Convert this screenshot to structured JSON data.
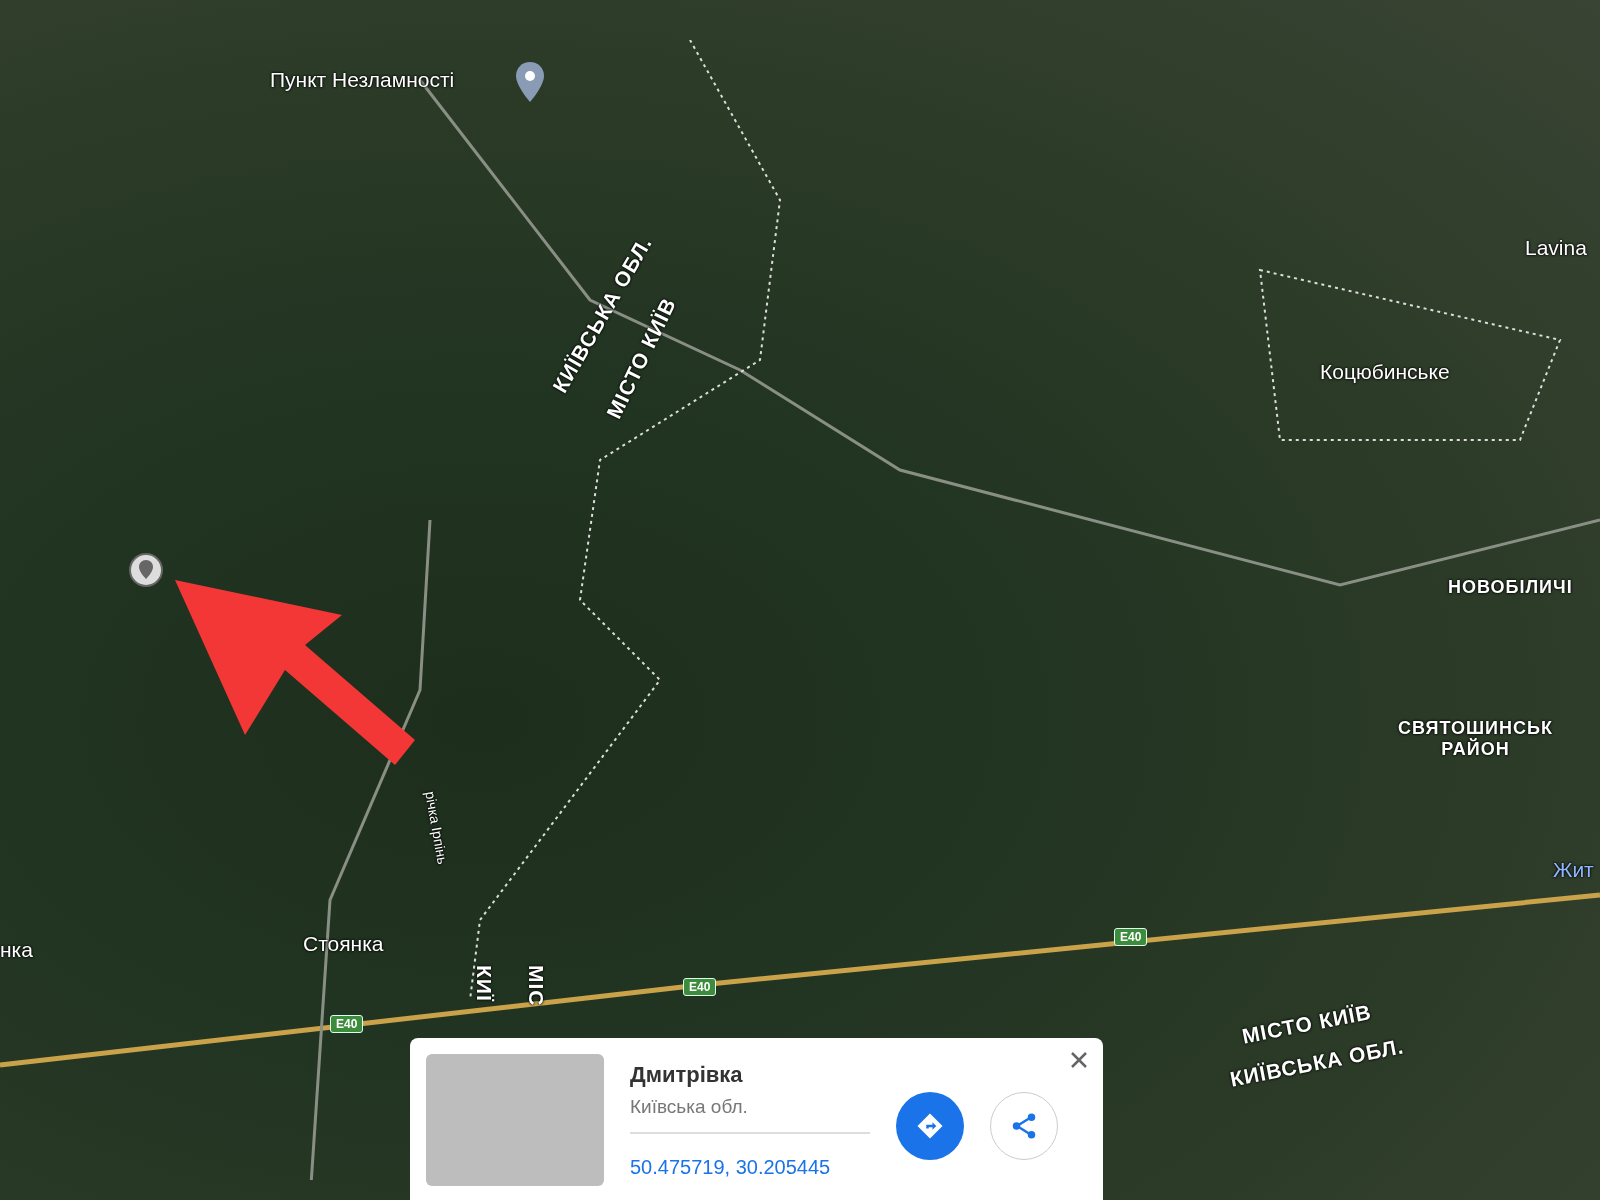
{
  "map": {
    "labels": [
      {
        "text": "Пункт Незламності",
        "kind": "place"
      },
      {
        "text": "Lavina",
        "kind": "place"
      },
      {
        "text": "Коцюбинське",
        "kind": "place"
      },
      {
        "text": "НОВОБІЛИЧІ",
        "kind": "district"
      },
      {
        "text": "СВЯТОШИНСЬК\nРАЙОН",
        "kind": "district"
      },
      {
        "text": "Жит",
        "kind": "water"
      },
      {
        "text": "Стоянка",
        "kind": "place"
      },
      {
        "text": "нка",
        "kind": "place"
      },
      {
        "text": "КИЇВСЬКА ОБЛ.",
        "kind": "border"
      },
      {
        "text": "МІСТО КИЇВ",
        "kind": "border"
      },
      {
        "text": "річка Ірпінь",
        "kind": "river"
      },
      {
        "text": "КИЇ",
        "kind": "border"
      },
      {
        "text": "МІС",
        "kind": "border"
      },
      {
        "text": "МІСТО КИЇВ",
        "kind": "border"
      },
      {
        "text": "КИЇВСЬКА ОБЛ.",
        "kind": "border"
      }
    ],
    "road_shields": [
      "E40",
      "E40",
      "E40"
    ]
  },
  "place_card": {
    "title": "Дмитрівка",
    "subtitle": "Київська обл.",
    "coordinates": "50.475719, 30.205445"
  }
}
